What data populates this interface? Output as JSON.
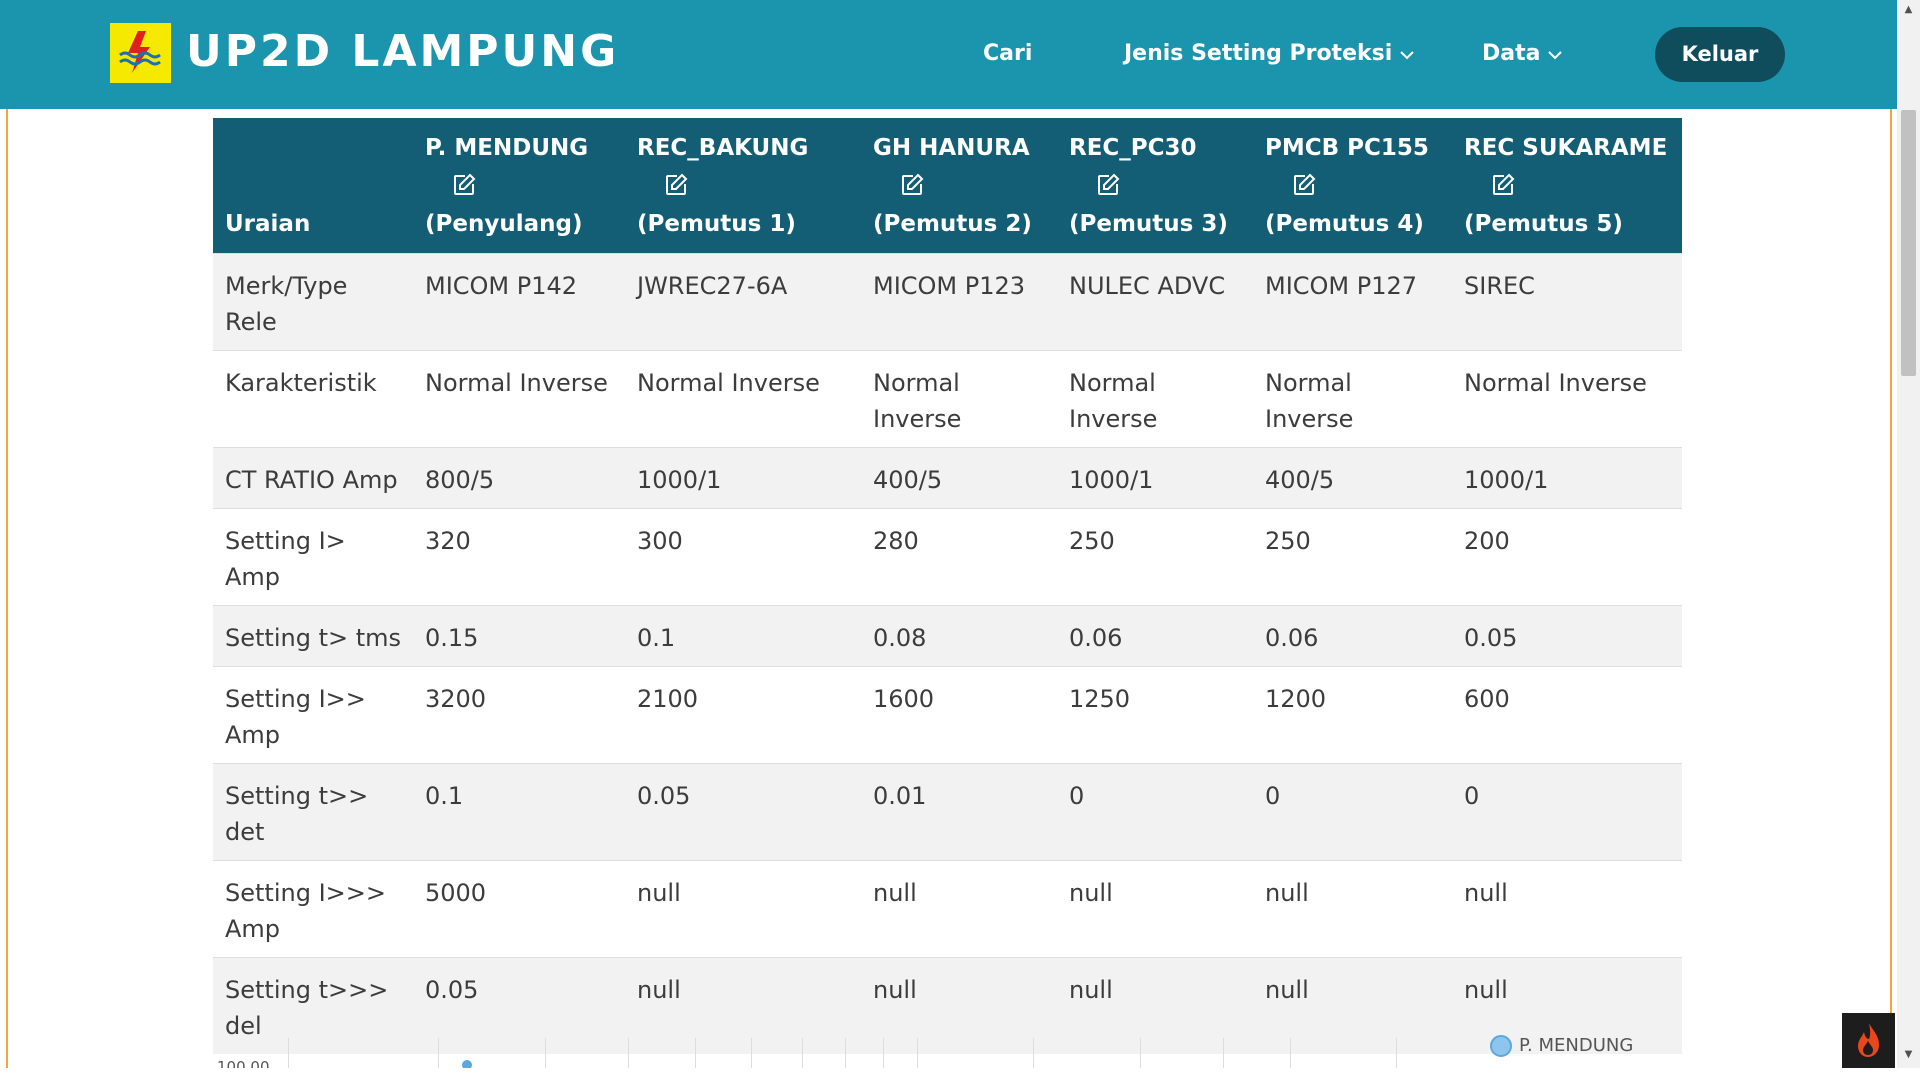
{
  "navbar": {
    "brand": "UP2D LAMPUNG",
    "links": {
      "cari": "Cari",
      "jenis": "Jenis Setting Proteksi",
      "data": "Data"
    },
    "logout": "Keluar"
  },
  "table": {
    "uraian_label": "Uraian",
    "columns": [
      {
        "name": "P. MENDUNG",
        "sub": "(Penyulang)"
      },
      {
        "name": "REC_BAKUNG",
        "sub": "(Pemutus 1)"
      },
      {
        "name": "GH HANURA",
        "sub": "(Pemutus 2)"
      },
      {
        "name": "REC_PC30",
        "sub": "(Pemutus 3)"
      },
      {
        "name": "PMCB PC155",
        "sub": "(Pemutus 4)"
      },
      {
        "name": "REC SUKARAME",
        "sub": "(Pemutus 5)"
      }
    ],
    "rows": [
      {
        "label": "Merk/Type Rele",
        "values": [
          "MICOM P142",
          "JWREC27-6A",
          "MICOM P123",
          "NULEC ADVC",
          "MICOM P127",
          "SIREC"
        ]
      },
      {
        "label": "Karakteristik",
        "values": [
          "Normal Inverse",
          "Normal Inverse",
          "Normal Inverse",
          "Normal Inverse",
          "Normal Inverse",
          "Normal Inverse"
        ]
      },
      {
        "label": "CT RATIO Amp",
        "values": [
          "800/5",
          "1000/1",
          "400/5",
          "1000/1",
          "400/5",
          "1000/1"
        ]
      },
      {
        "label": "Setting I> Amp",
        "values": [
          "320",
          "300",
          "280",
          "250",
          "250",
          "200"
        ]
      },
      {
        "label": "Setting t> tms",
        "values": [
          "0.15",
          "0.1",
          "0.08",
          "0.06",
          "0.06",
          "0.05"
        ]
      },
      {
        "label": "Setting I>> Amp",
        "values": [
          "3200",
          "2100",
          "1600",
          "1250",
          "1200",
          "600"
        ]
      },
      {
        "label": "Setting t>> det",
        "values": [
          "0.1",
          "0.05",
          "0.01",
          "0",
          "0",
          "0"
        ]
      },
      {
        "label": "Setting I>>> Amp",
        "values": [
          "5000",
          "null",
          "null",
          "null",
          "null",
          "null"
        ]
      },
      {
        "label": "Setting t>>> del",
        "values": [
          "0.05",
          "null",
          "null",
          "null",
          "null",
          "null"
        ]
      }
    ]
  },
  "chart_peek": {
    "y_tick": "100.00",
    "legend": "P. MENDUNG"
  },
  "icons": {
    "edit": "edit-icon",
    "chevron": "chevron-down-icon",
    "logo": "pln-logo",
    "fire": "fire-icon"
  }
}
